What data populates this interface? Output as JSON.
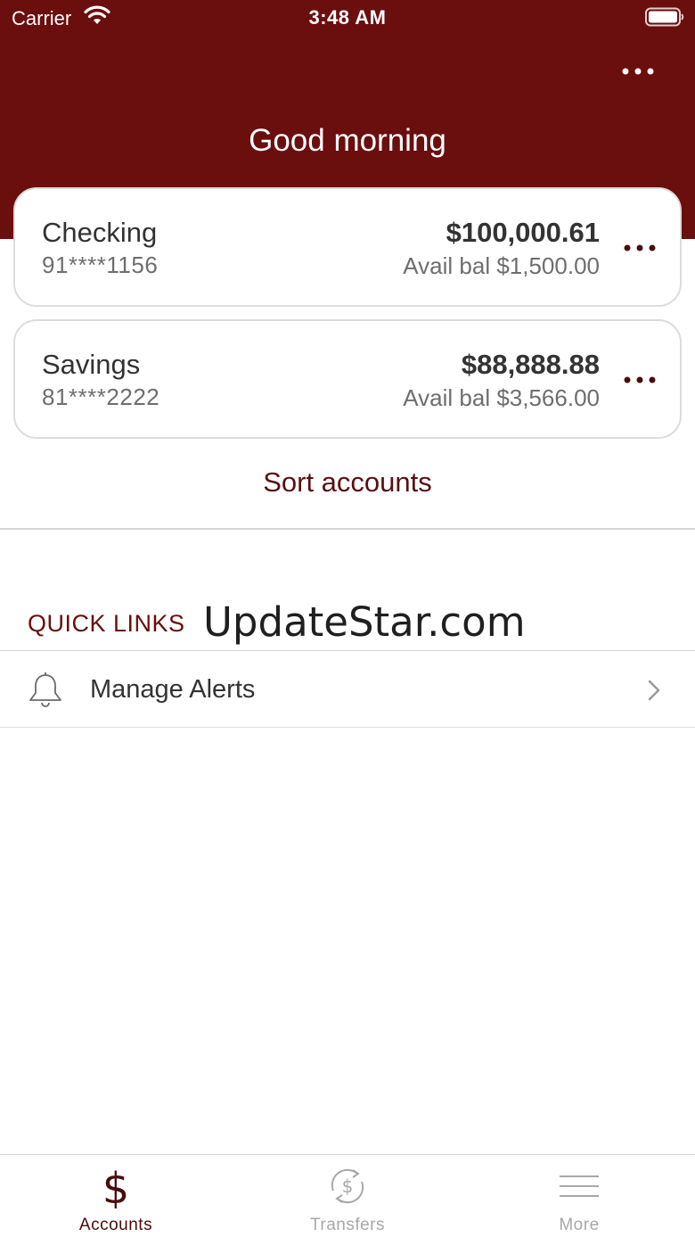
{
  "status_bar": {
    "carrier": "Carrier",
    "time": "3:48 AM"
  },
  "header": {
    "greeting": "Good morning",
    "more_icon": "ellipsis-icon"
  },
  "accounts": [
    {
      "name": "Checking",
      "number": "91****1156",
      "balance": "$100,000.61",
      "available": "Avail bal $1,500.00"
    },
    {
      "name": "Savings",
      "number": "81****2222",
      "balance": "$88,888.88",
      "available": "Avail bal $3,566.00"
    }
  ],
  "sort_accounts_label": "Sort accounts",
  "quick_links": {
    "heading": "QUICK LINKS",
    "watermark": "UpdateStar.com",
    "items": [
      {
        "label": "Manage Alerts",
        "icon": "bell-icon"
      }
    ]
  },
  "tab_bar": {
    "tabs": [
      {
        "label": "Accounts",
        "icon": "dollar-icon",
        "active": true
      },
      {
        "label": "Transfers",
        "icon": "transfer-dollar-icon",
        "active": false
      },
      {
        "label": "More",
        "icon": "menu-icon",
        "active": false
      }
    ]
  },
  "colors": {
    "brand": "#6a0e0e",
    "brand_text": "#5a1010",
    "inactive_tab": "#a8a8a8"
  }
}
